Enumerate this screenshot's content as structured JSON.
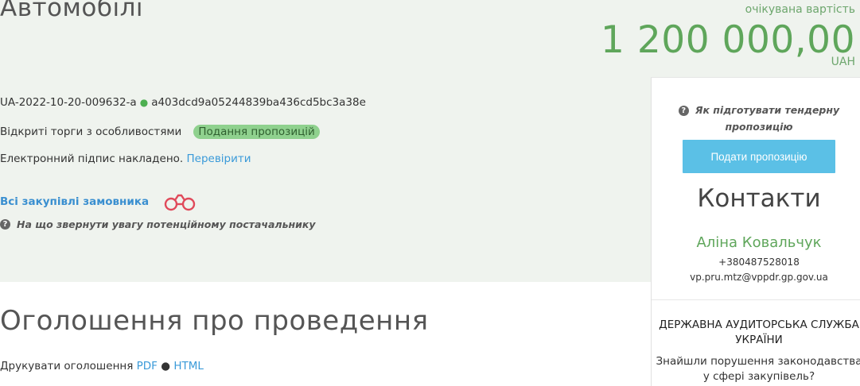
{
  "header": {
    "title": "Автомобілі",
    "expected_value_label": "очікувана вартість",
    "expected_value_amount": "1 200 000,00",
    "currency": "UAH"
  },
  "tender": {
    "id": "UA-2022-10-20-009632-a",
    "separator": "●",
    "hash": "a403dcd9a05244839ba436cd5bc3a38e",
    "procedure_type": "Відкриті торги з особливостями",
    "status": "Подання пропозицій",
    "signature_text": "Електронний підпис накладено.",
    "signature_check_link": "Перевірити",
    "all_purchases_link": "Всі закупівлі замовника",
    "supplier_hint": "На що звернути увагу потенційному постачальнику"
  },
  "announcement": {
    "title": "Оголошення про проведення",
    "print_label": "Друкувати оголошення",
    "pdf_link": "PDF",
    "separator": "●",
    "html_link": "HTML"
  },
  "sidebar": {
    "how_to_prepare": "Як підготувати тендерну пропозицію",
    "submit_bid_button": "Подати пропозицію",
    "contacts_title": "Контакти",
    "contact_name": "Аліна Ковальчук",
    "contact_phone": "+380487528018",
    "contact_email": "vp.pru.mtz@vppdr.gp.gov.ua",
    "audit_service_title": "Державна аудиторська служба України",
    "audit_service_text": "Знайшли порушення законодавства у сфері закупівель?"
  },
  "colors": {
    "top_band_bg": "#eff3ee",
    "accent_green": "#5fa65b",
    "link_blue": "#3a9ad9",
    "button_blue": "#5bc0e6",
    "status_badge_bg": "#8fd18e"
  },
  "icons": {
    "binoculars": "binoculars-icon",
    "question": "question-circle-icon"
  }
}
